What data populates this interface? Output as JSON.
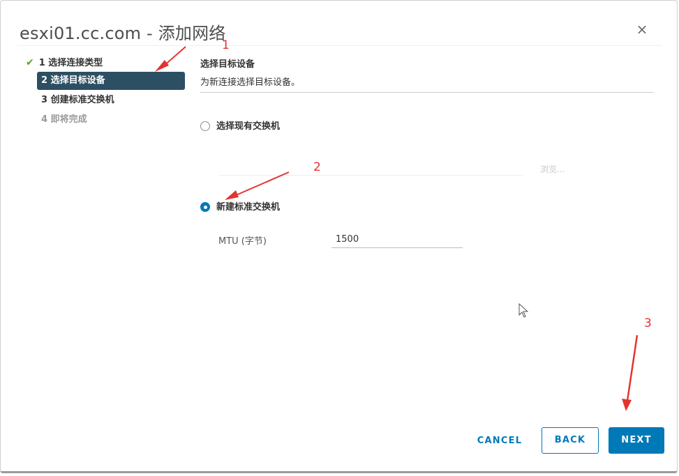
{
  "dialog": {
    "title": "esxi01.cc.com - 添加网络",
    "close_glyph": "×"
  },
  "steps": [
    {
      "label": "1 选择连接类型",
      "state": "done"
    },
    {
      "label": "2 选择目标设备",
      "state": "active"
    },
    {
      "label": "3 创建标准交换机",
      "state": "pending"
    },
    {
      "label": "4 即将完成",
      "state": "disabled"
    }
  ],
  "main": {
    "section_title": "选择目标设备",
    "section_desc": "为新连接选择目标设备。",
    "option_existing": "选择现有交换机",
    "browse_label": "浏览...",
    "option_new": "新建标准交换机",
    "mtu_label": "MTU (字节)",
    "mtu_value": "1500"
  },
  "footer": {
    "cancel_label": "CANCEL",
    "back_label": "BACK",
    "next_label": "NEXT"
  },
  "annotations": [
    "1",
    "2",
    "3"
  ],
  "colors": {
    "accent": "#0079b8",
    "active_step_bg": "#2d4f63",
    "check": "#5aa220",
    "annotation": "#e3342f"
  }
}
